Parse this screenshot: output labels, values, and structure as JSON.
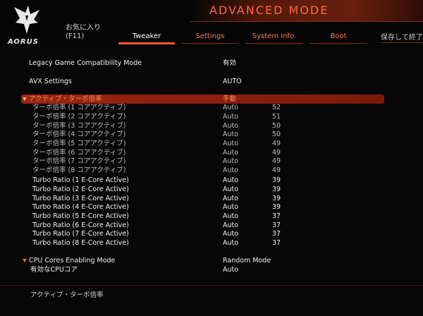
{
  "header": {
    "logo_text": "AORUS",
    "mode_title": "ADVANCED MODE",
    "favorites_line1": "お気に入り",
    "favorites_line2": "(F11)",
    "tabs": [
      {
        "label": "Tweaker",
        "active": true
      },
      {
        "label": "Settings",
        "active": false
      },
      {
        "label": "System Info.",
        "active": false
      },
      {
        "label": "Boot",
        "active": false
      }
    ],
    "save_exit_label": "保存して終了"
  },
  "settings": {
    "legacy": {
      "label": "Legacy Game Compatibility Mode",
      "value": "有効"
    },
    "avx": {
      "label": "AVX Settings",
      "value": "AUTO"
    },
    "active_turbo": {
      "label": "アクティブ・ターボ倍率",
      "value": "手動"
    },
    "p_core_ratios": [
      {
        "label": "ターボ倍率 (1 コアアクティブ)",
        "value": "Auto",
        "extra": "52"
      },
      {
        "label": "ターボ倍率 (2 コアアクティブ)",
        "value": "Auto",
        "extra": "51"
      },
      {
        "label": "ターボ倍率 (3 コアアクティブ)",
        "value": "Auto",
        "extra": "50"
      },
      {
        "label": "ターボ倍率 (4 コアアクティブ)",
        "value": "Auto",
        "extra": "50"
      },
      {
        "label": "ターボ倍率 (5 コアアクティブ)",
        "value": "Auto",
        "extra": "49"
      },
      {
        "label": "ターボ倍率 (6 コアアクティブ)",
        "value": "Auto",
        "extra": "49"
      },
      {
        "label": "ターボ倍率 (7 コアアクティブ)",
        "value": "Auto",
        "extra": "49"
      },
      {
        "label": "ターボ倍率 (8 コアアクティブ)",
        "value": "Auto",
        "extra": "49"
      }
    ],
    "e_core_ratios": [
      {
        "label": "Turbo Ratio (1 E-Core Active)",
        "value": "Auto",
        "extra": "39"
      },
      {
        "label": "Turbo Ratio (2 E-Core Active)",
        "value": "Auto",
        "extra": "39"
      },
      {
        "label": "Turbo Ratio (3 E-Core Active)",
        "value": "Auto",
        "extra": "39"
      },
      {
        "label": "Turbo Ratio (4 E-Core Active)",
        "value": "Auto",
        "extra": "39"
      },
      {
        "label": "Turbo Ratio (5 E-Core Active)",
        "value": "Auto",
        "extra": "37"
      },
      {
        "label": "Turbo Ratio (6 E-Core Active)",
        "value": "Auto",
        "extra": "37"
      },
      {
        "label": "Turbo Ratio (7 E-Core Active)",
        "value": "Auto",
        "extra": "37"
      },
      {
        "label": "Turbo Ratio (8 E-Core Active)",
        "value": "Auto",
        "extra": "37"
      }
    ],
    "cpu_cores_enabling": {
      "label": "CPU Cores Enabling Mode",
      "value": "Random Mode"
    },
    "active_cpu_cores": {
      "label": "有効なCPUコア",
      "value": "Auto"
    }
  },
  "help_text": "アクティブ・ターボ倍率",
  "colors": {
    "accent": "#ff6a3a",
    "selected_row": "#9c2410",
    "background": "#070707"
  }
}
